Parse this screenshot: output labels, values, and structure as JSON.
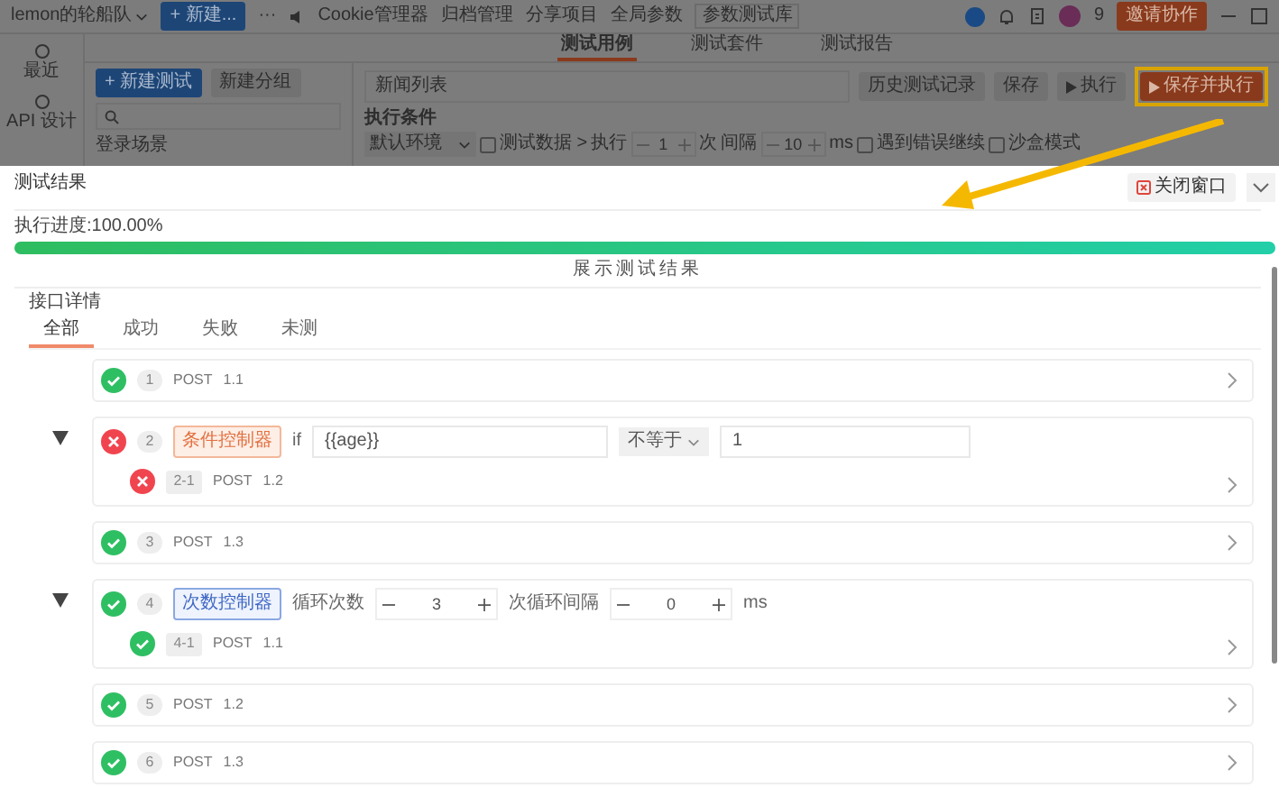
{
  "topbar": {
    "team": "lemon的轮船队",
    "new_button": "+ 新建...",
    "more": "···",
    "links": [
      "Cookie管理器",
      "归档管理",
      "分享项目",
      "全局参数",
      "参数测试库"
    ],
    "notification_count": "9",
    "invite_button": "邀请协作"
  },
  "sidebar": {
    "items": [
      {
        "label": "最近"
      },
      {
        "label": "API 设计"
      }
    ]
  },
  "tabs": [
    {
      "label": "测试用例",
      "selected": true
    },
    {
      "label": "测试套件",
      "selected": false
    },
    {
      "label": "测试报告",
      "selected": false
    }
  ],
  "left_panel": {
    "new_test_button": "+ 新建测试",
    "new_group_button": "新建分组",
    "tree_item": "登录场景"
  },
  "case": {
    "name": "新闻列表",
    "buttons": [
      {
        "label": "历史测试记录",
        "kind": "history",
        "highlighted": false
      },
      {
        "label": "保存",
        "kind": "save",
        "highlighted": false
      },
      {
        "label": "执行",
        "kind": "run",
        "highlighted": false
      },
      {
        "label": "保存并执行",
        "kind": "primary",
        "highlighted": true
      }
    ],
    "conditions_title": "执行条件",
    "environment": "默认环境",
    "test_data": {
      "label": "测试数据 >",
      "checked": false
    },
    "run_label": "执行",
    "run_count": "1",
    "count_unit": "次",
    "interval_label": "间隔",
    "interval": "10",
    "interval_unit": "ms",
    "continue_on_error": {
      "label": "遇到错误继续",
      "checked": false
    },
    "sandbox": {
      "label": "沙盒模式",
      "checked": false
    }
  },
  "result": {
    "title": "测试结果",
    "close_button": "关闭窗口",
    "progress_label": "执行进度:100.00%",
    "progress": {
      "level": 1
    },
    "show_results": "展示测试结果",
    "details_title": "接口详情",
    "filters": [
      {
        "label": "全部",
        "selected": true
      },
      {
        "label": "成功",
        "selected": false
      },
      {
        "label": "失败",
        "selected": false
      },
      {
        "label": "未测",
        "selected": false
      }
    ],
    "steps": [
      {
        "kind": "request",
        "passed": true,
        "index": "1",
        "method": "POST",
        "name": "1.1"
      },
      {
        "kind": "condition",
        "passed": false,
        "index": "2",
        "expanded": true,
        "tag": "条件控制器",
        "keyword": "if",
        "variable": "{{age}}",
        "operator": "不等于",
        "value": "1",
        "children": [
          {
            "kind": "request",
            "passed": false,
            "index": "2-1",
            "method": "POST",
            "name": "1.2"
          }
        ]
      },
      {
        "kind": "request",
        "passed": true,
        "index": "3",
        "method": "POST",
        "name": "1.3"
      },
      {
        "kind": "loop",
        "passed": true,
        "index": "4",
        "expanded": true,
        "tag": "次数控制器",
        "count_label": "循环次数",
        "count": "3",
        "interval_label": "次循环间隔",
        "interval": "0",
        "interval_unit": "ms",
        "children": [
          {
            "kind": "request",
            "passed": true,
            "index": "4-1",
            "method": "POST",
            "name": "1.1"
          }
        ]
      },
      {
        "kind": "request",
        "passed": true,
        "index": "5",
        "method": "POST",
        "name": "1.2"
      },
      {
        "kind": "request",
        "passed": true,
        "index": "6",
        "method": "POST",
        "name": "1.3"
      }
    ]
  }
}
